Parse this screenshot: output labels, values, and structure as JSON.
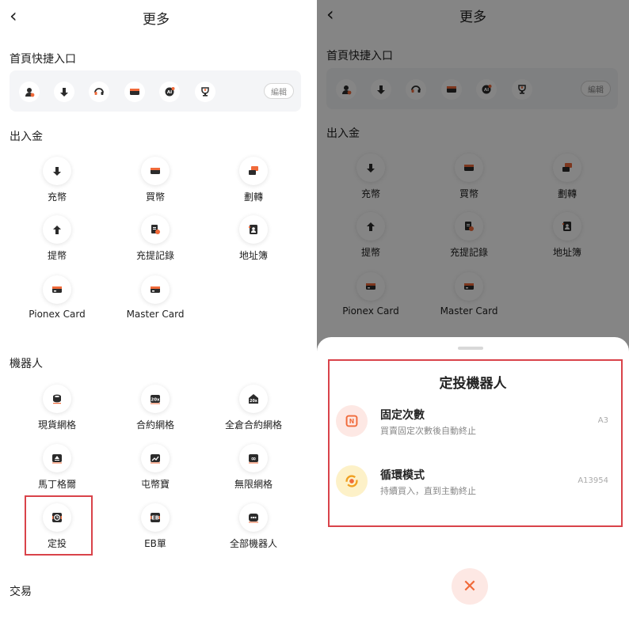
{
  "header": {
    "title": "更多",
    "back_glyph": "‹"
  },
  "quick_entry": {
    "title": "首頁快捷入口",
    "icons": [
      "user-icon",
      "download-icon",
      "headset-icon",
      "card-icon",
      "ai-icon",
      "trophy-icon"
    ],
    "edit_label": "編輯"
  },
  "deposit_section": {
    "title": "出入金",
    "items": [
      {
        "label": "充幣",
        "icon": "download-icon"
      },
      {
        "label": "買幣",
        "icon": "card-icon"
      },
      {
        "label": "劃轉",
        "icon": "transfer-icon"
      },
      {
        "label": "提幣",
        "icon": "upload-icon"
      },
      {
        "label": "充提記錄",
        "icon": "record-icon"
      },
      {
        "label": "地址簿",
        "icon": "address-book-icon"
      },
      {
        "label": "Pionex Card",
        "icon": "pionex-card-icon"
      },
      {
        "label": "Master Card",
        "icon": "master-card-icon"
      }
    ]
  },
  "bots_section": {
    "title": "機器人",
    "items": [
      {
        "label": "現貨網格",
        "icon": "spot-grid-icon"
      },
      {
        "label": "合約網格",
        "icon": "futures-grid-icon"
      },
      {
        "label": "全倉合約網格",
        "icon": "cross-futures-grid-icon"
      },
      {
        "label": "馬丁格爾",
        "icon": "martingale-icon"
      },
      {
        "label": "屯幣寶",
        "icon": "hodl-icon"
      },
      {
        "label": "無限網格",
        "icon": "infinity-grid-icon"
      },
      {
        "label": "定投",
        "icon": "dca-clock-icon"
      },
      {
        "label": "EB單",
        "icon": "eb-order-icon"
      },
      {
        "label": "全部機器人",
        "icon": "all-bots-icon"
      }
    ]
  },
  "trade_section": {
    "title": "交易"
  },
  "sheet": {
    "title": "定投機器人",
    "options": [
      {
        "title": "固定次數",
        "subtitle": "買賣固定次數後自動終止",
        "count": "A3",
        "icon": "fixed-count-icon"
      },
      {
        "title": "循環模式",
        "subtitle": "持續買入，直到主動終止",
        "count": "A13954",
        "icon": "loop-mode-icon"
      }
    ],
    "close_glyph": "✕"
  },
  "colors": {
    "accent": "#f06a3a",
    "dark_icon": "#2b2b2b",
    "highlight": "#d9434a",
    "loop_icon_bg": "#fdf1c8",
    "fixed_icon_bg": "#fde8e4"
  }
}
